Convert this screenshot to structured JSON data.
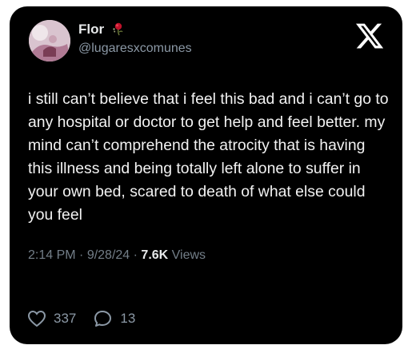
{
  "user": {
    "display_name": "Flor",
    "handle": "@lugaresxcomunes",
    "badge_icon": "flower-icon"
  },
  "brand": {
    "logo_icon": "x-logo-icon"
  },
  "tweet": {
    "text": "i still can’t believe that i feel this bad and i can’t go to any hospital or doctor to get help and feel better. my mind can’t comprehend the atrocity that is having this illness and being totally left alone to suffer in your own bed, scared to death of what else could you feel",
    "time": "2:14 PM",
    "date": "9/28/24",
    "separator": " · ",
    "views_count": "7.6K",
    "views_label": " Views"
  },
  "actions": {
    "likes": "337",
    "replies": "13"
  },
  "colors": {
    "background": "#000000",
    "text": "#e7e9ea",
    "muted": "#8b98a5"
  }
}
